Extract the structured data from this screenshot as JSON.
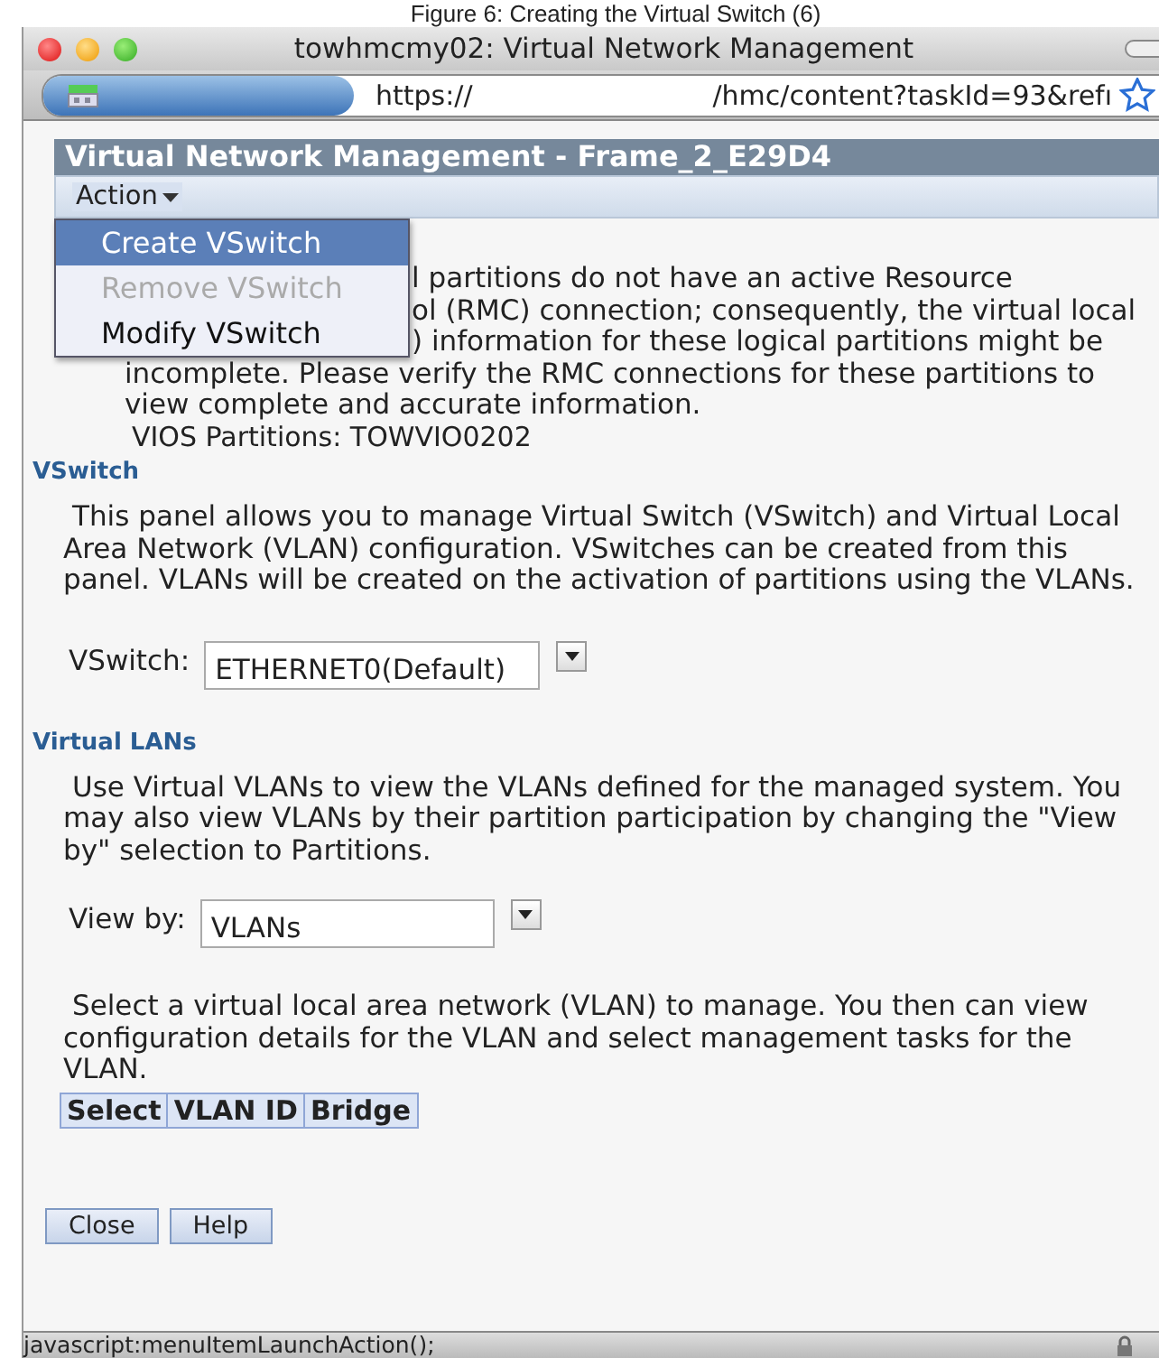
{
  "caption": "Figure 6: Creating the Virtual Switch (6)",
  "window": {
    "title": "towhmcmy02: Virtual Network Management"
  },
  "address_bar": {
    "scheme": "https://",
    "path": "/hmc/content?taskId=93&refı"
  },
  "header": {
    "title": "Virtual Network Management - Frame_2_E29D4"
  },
  "action_menu": {
    "label": "Action",
    "expanded": true,
    "items": [
      {
        "label": "Create VSwitch",
        "selected": true,
        "disabled": false
      },
      {
        "label": "Remove VSwitch",
        "selected": false,
        "disabled": true
      },
      {
        "label": "Modify VSwitch",
        "selected": false,
        "disabled": false
      }
    ]
  },
  "warning": {
    "lines": [
      "l partitions do not have an active Resource",
      "ol (RMC) connection; consequently, the virtual local",
      ") information for these logical partitions might be",
      "incomplete. Please verify the RMC connections for these partitions to",
      "view complete and accurate information."
    ],
    "vios": "VIOS Partitions: TOWVIO0202"
  },
  "vswitch_section": {
    "heading": "VSwitch",
    "description": "This panel allows you to manage Virtual Switch (VSwitch) and Virtual Local Area Network (VLAN) configuration. VSwitches can be created from this panel. VLANs will be created on the activation of partitions using the VLANs.",
    "field_label": "VSwitch:",
    "value": "ETHERNET0(Default)"
  },
  "vlan_section": {
    "heading": "Virtual LANs",
    "description": "Use Virtual VLANs to view the VLANs defined for the managed system. You may also view VLANs by their partition participation by changing the \"View by\" selection to Partitions.",
    "field_label": "View by:",
    "value": "VLANs",
    "instructions": "Select a virtual local area network (VLAN) to manage. You then can view configuration details for the VLAN and select management tasks for the VLAN.",
    "table": {
      "columns": [
        "Select",
        "VLAN ID",
        "Bridge"
      ]
    }
  },
  "buttons": [
    "Close",
    "Help"
  ],
  "status_bar": "javascript:menuItemLaunchAction();"
}
